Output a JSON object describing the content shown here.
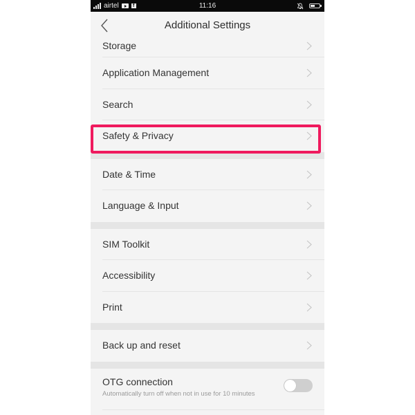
{
  "status_bar": {
    "carrier": "airtel",
    "time": "11:16",
    "notification_icons": [
      "youtube-icon",
      "facebook-icon"
    ],
    "right_icons": [
      "mute-icon",
      "battery-icon"
    ],
    "battery_level_percent": 55
  },
  "app_bar": {
    "back_icon": "chevron-left-icon",
    "title": "Additional Settings"
  },
  "sections": [
    {
      "items": [
        {
          "label": "Storage",
          "icon": "chevron-right-icon"
        },
        {
          "label": "Application Management",
          "icon": "chevron-right-icon"
        },
        {
          "label": "Search",
          "icon": "chevron-right-icon"
        },
        {
          "label": "Safety & Privacy",
          "icon": "chevron-right-icon",
          "highlighted": true
        }
      ]
    },
    {
      "items": [
        {
          "label": "Date & Time",
          "icon": "chevron-right-icon"
        },
        {
          "label": "Language & Input",
          "icon": "chevron-right-icon"
        }
      ]
    },
    {
      "items": [
        {
          "label": "SIM Toolkit",
          "icon": "chevron-right-icon"
        },
        {
          "label": "Accessibility",
          "icon": "chevron-right-icon"
        },
        {
          "label": "Print",
          "icon": "chevron-right-icon"
        }
      ]
    },
    {
      "items": [
        {
          "label": "Back up and reset",
          "icon": "chevron-right-icon"
        }
      ]
    },
    {
      "items": [
        {
          "label": "OTG connection",
          "subtitle": "Automatically turn off when not in use for 10 minutes",
          "type": "toggle",
          "enabled": false
        }
      ]
    }
  ],
  "colors": {
    "highlight": "#ef1a5e",
    "status_bar_bg": "#0a0a0a",
    "list_bg": "#f4f4f4",
    "section_gap": "#e5e5e5",
    "toggle_off": "#cfcfcf"
  }
}
